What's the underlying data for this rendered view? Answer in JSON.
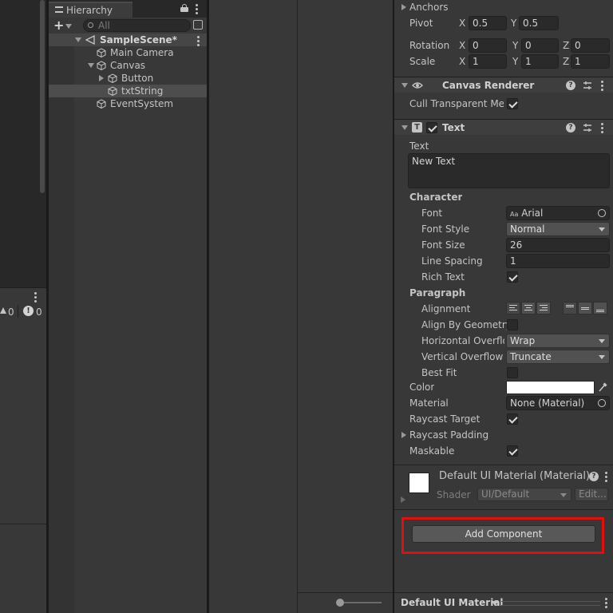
{
  "console": {
    "warn_count": "0",
    "error_count": "0"
  },
  "hierarchy": {
    "tab_label": "Hierarchy",
    "search_placeholder": "All",
    "scene": "SampleScene*",
    "items": [
      "Main Camera",
      "Canvas",
      "Button",
      "txtString",
      "EventSystem"
    ]
  },
  "inspector": {
    "rect": {
      "anchors_label": "Anchors",
      "pivot_label": "Pivot",
      "pivot": {
        "x": "0.5",
        "y": "0.5"
      },
      "rotation_label": "Rotation",
      "rotation": {
        "x": "0",
        "y": "0",
        "z": "0"
      },
      "scale_label": "Scale",
      "scale": {
        "x": "1",
        "y": "1",
        "z": "1"
      },
      "axis": {
        "x": "X",
        "y": "Y",
        "z": "Z"
      }
    },
    "canvas_renderer": {
      "title": "Canvas Renderer",
      "cull_label": "Cull Transparent Mes"
    },
    "text": {
      "title": "Text",
      "text_label": "Text",
      "text_value": "New Text",
      "character_label": "Character",
      "font_label": "Font",
      "font_value": "Arial",
      "font_prefix": "Aa",
      "font_style_label": "Font Style",
      "font_style_value": "Normal",
      "font_size_label": "Font Size",
      "font_size_value": "26",
      "line_spacing_label": "Line Spacing",
      "line_spacing_value": "1",
      "rich_text_label": "Rich Text",
      "paragraph_label": "Paragraph",
      "alignment_label": "Alignment",
      "align_geom_label": "Align By Geometry",
      "h_overflow_label": "Horizontal Overflow",
      "h_overflow_value": "Wrap",
      "v_overflow_label": "Vertical Overflow",
      "v_overflow_value": "Truncate",
      "best_fit_label": "Best Fit",
      "color_label": "Color",
      "color_value": "#ffffff",
      "material_label": "Material",
      "material_value": "None (Material)",
      "raycast_target_label": "Raycast Target",
      "raycast_padding_label": "Raycast Padding",
      "maskable_label": "Maskable"
    },
    "material_preview": {
      "title": "Default UI Material (Material)",
      "shader_label": "Shader",
      "shader_value": "UI/Default",
      "edit_label": "Edit..."
    },
    "add_component_label": "Add Component",
    "footer_dropdown": "Default UI Material"
  },
  "colors": {
    "highlight_box": "#e01010",
    "selected_row": "#4d4d4d"
  }
}
